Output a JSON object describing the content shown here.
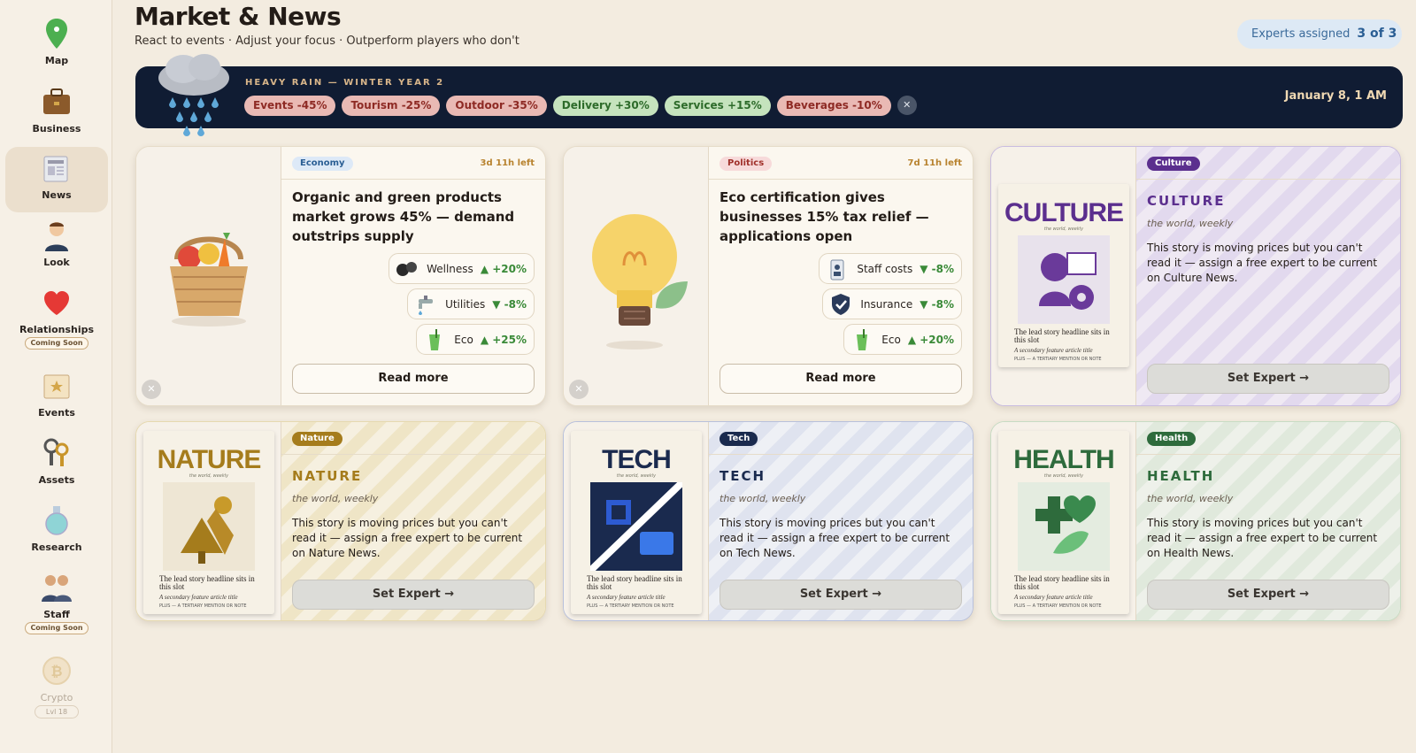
{
  "sidebar": {
    "items": [
      {
        "label": "Map",
        "icon": "map-pin-icon"
      },
      {
        "label": "Business",
        "icon": "briefcase-icon"
      },
      {
        "label": "News",
        "icon": "newspaper-icon",
        "active": true
      },
      {
        "label": "Look",
        "icon": "person-avatar-icon"
      },
      {
        "label": "Relationships",
        "icon": "heart-icon",
        "badge": "Coming Soon"
      },
      {
        "label": "Events",
        "icon": "calendar-star-icon"
      },
      {
        "label": "Assets",
        "icon": "keys-icon"
      },
      {
        "label": "Research",
        "icon": "flask-icon"
      },
      {
        "label": "Staff",
        "icon": "people-icon",
        "badge": "Coming Soon"
      },
      {
        "label": "Crypto",
        "icon": "bitcoin-coin-icon",
        "lock": "Lvl 18"
      }
    ]
  },
  "header": {
    "title": "Market & News",
    "subtitle": "React to events · Adjust your focus · Outperform players who don't",
    "experts_label": "Experts assigned",
    "experts_value": "3 of 3"
  },
  "banner": {
    "event": "HEAVY RAIN — WINTER YEAR 2",
    "date": "January 8, 1 AM",
    "effects": [
      {
        "text": "Events -45%",
        "kind": "neg"
      },
      {
        "text": "Tourism -25%",
        "kind": "neg"
      },
      {
        "text": "Outdoor -35%",
        "kind": "neg"
      },
      {
        "text": "Delivery +30%",
        "kind": "pos"
      },
      {
        "text": "Services +15%",
        "kind": "pos"
      },
      {
        "text": "Beverages -10%",
        "kind": "neg"
      }
    ]
  },
  "news": [
    {
      "category": "Economy",
      "time_left": "3d 11h left",
      "headline": "Organic and green products market grows 45% — demand outstrips supply",
      "effects": [
        {
          "name": "Wellness",
          "value": "▲ +20%"
        },
        {
          "name": "Utilities",
          "value": "▼ -8%"
        },
        {
          "name": "Eco",
          "value": "▲ +25%"
        }
      ],
      "read_more": "Read more"
    },
    {
      "category": "Politics",
      "time_left": "7d 11h left",
      "headline": "Eco certification gives businesses 15% tax relief — applications open",
      "effects": [
        {
          "name": "Staff costs",
          "value": "▼ -8%"
        },
        {
          "name": "Insurance",
          "value": "▼ -8%"
        },
        {
          "name": "Eco",
          "value": "▲ +20%"
        }
      ],
      "read_more": "Read more"
    }
  ],
  "locked": [
    {
      "tag": "Culture",
      "title": "CULTURE",
      "tagline": "the world, weekly",
      "story": "This story is moving prices but you can't read it — assign a free expert to be current on Culture News.",
      "button": "Set Expert →",
      "masthead": "CULTURE",
      "color": "#5b2f8e"
    },
    {
      "tag": "Nature",
      "title": "NATURE",
      "tagline": "the world, weekly",
      "story": "This story is moving prices but you can't read it — assign a free expert to be current on Nature News.",
      "button": "Set Expert →",
      "masthead": "NATURE",
      "color": "#a57c1c"
    },
    {
      "tag": "Tech",
      "title": "TECH",
      "tagline": "the world, weekly",
      "story": "This story is moving prices but you can't read it — assign a free expert to be current on Tech News.",
      "button": "Set Expert →",
      "masthead": "TECH",
      "color": "#1a2a4e"
    },
    {
      "tag": "Health",
      "title": "HEALTH",
      "tagline": "the world, weekly",
      "story": "This story is moving prices but you can't read it — assign a free expert to be current on Health News.",
      "button": "Set Expert →",
      "masthead": "HEALTH",
      "color": "#2e6b3c"
    }
  ],
  "cover_text": {
    "sub": "the world, weekly",
    "lead": "The lead story headline sits in this slot",
    "second": "A secondary feature article title",
    "third": "PLUS — A TERTIARY MENTION OR NOTE"
  },
  "colors": {
    "positive": "#3a8a38",
    "negative": "#8e2a24",
    "banner_bg": "#101c33",
    "accent_blue": "#2a5e94"
  }
}
